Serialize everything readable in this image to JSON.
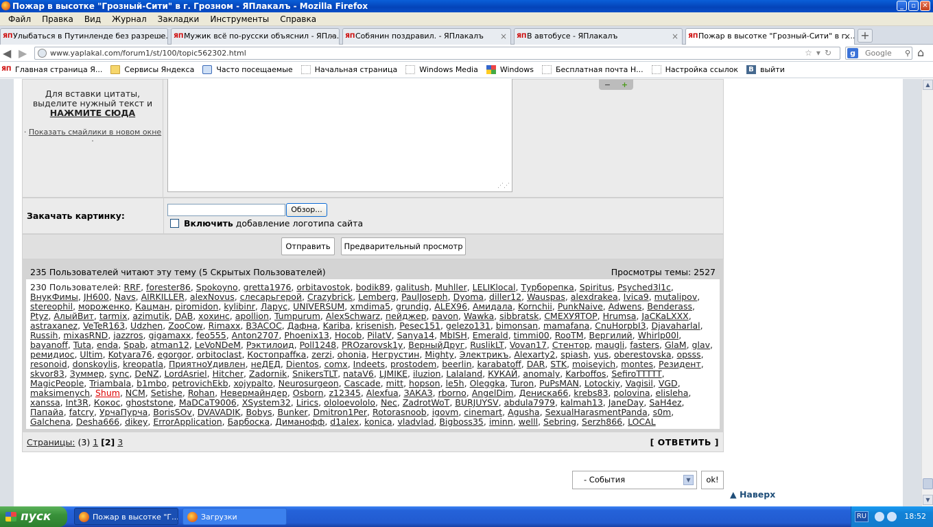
{
  "window": {
    "title": "Пожар в высотке \"Грозный-Сити\" в г. Грозном - ЯПлакалъ - Mozilla Firefox"
  },
  "menu": [
    "Файл",
    "Правка",
    "Вид",
    "Журнал",
    "Закладки",
    "Инструменты",
    "Справка"
  ],
  "tabs": [
    {
      "label": "Улыбаться в Путинленде без разреше..."
    },
    {
      "label": "Мужик всё по-русски объяснил - ЯПла..."
    },
    {
      "label": "Собянин поздравил. - ЯПлакалъ"
    },
    {
      "label": "В автобусе - ЯПлакалъ"
    },
    {
      "label": "Пожар в высотке \"Грозный-Сити\" в г. ..."
    }
  ],
  "tab_icon": "ЯП",
  "nav": {
    "url": "www.yaplakal.com/forum1/st/100/topic562302.html",
    "search_placeholder": "Google"
  },
  "bookmarks": [
    {
      "label": "Главная страница Я...",
      "icon": "ЯП"
    },
    {
      "label": "Сервисы Яндекса",
      "icon": "folder-icon"
    },
    {
      "label": "Часто посещаемые",
      "icon": "search-icon"
    },
    {
      "label": "Начальная страница",
      "icon": "page-icon"
    },
    {
      "label": "Windows Media",
      "icon": "page-icon"
    },
    {
      "label": "Windows",
      "icon": "windows-icon"
    },
    {
      "label": "Бесплатная почта Н...",
      "icon": "page-icon"
    },
    {
      "label": "Настройка ссылок",
      "icon": "page-icon"
    },
    {
      "label": "выйти",
      "icon": "В"
    }
  ],
  "form": {
    "quote_help": [
      "Для вставки цитаты,",
      "выделите нужный текст и"
    ],
    "quote_click": "НАЖМИТЕ СЮДА",
    "show_smiles": "Показать смайлики в новом окне",
    "upload_label": "Закачать картинку:",
    "browse": "Обзор...",
    "logo_bold": "Включить",
    "logo_rest": " добавление логотипа сайта",
    "send": "Отправить",
    "preview": "Предварительный просмотр"
  },
  "readers": {
    "header": "235 Пользователей читают эту тему (5 Скрытых Пользователей)",
    "views": "Просмотры темы: 2527",
    "prefix": "230 Пользователей: ",
    "users": [
      "RRF",
      "forester86",
      "Spokoyno",
      "gretta1976",
      "orbitavostok",
      "bodik89",
      "galitush",
      "Muhller",
      "LELIKlocal",
      "Турборепка",
      "Spiritus",
      "Psyched3l1c",
      "ВнукФимы",
      "JH600",
      "Navs",
      "AIRKILLER",
      "alexNovus",
      "слесарьгерой",
      "Crazybrick",
      "Lemberg",
      "PaulJoseph",
      "Dyoma",
      "diller12",
      "Wauspas",
      "alexdrakea",
      "Ivica9",
      "mutalipov",
      "stereophil",
      "мороженко",
      "Кацман",
      "piromidon",
      "kylibinr",
      "Ларус",
      "UNIVERSUM",
      "xmdima5",
      "grundig",
      "ALEX96",
      "Амидала",
      "Kornchii",
      "PunkNaive",
      "Adwens",
      "Benderass",
      "Ptyz",
      "АлыйВит",
      "tarmix",
      "azimutik",
      "DAB",
      "хохинс",
      "apollion",
      "Tumpurum",
      "AlexSchwarz",
      "пейджер",
      "pavon",
      "Wawka",
      "sibbratsk",
      "СМЕХУЯТОР",
      "Hrumsa",
      "JaCKaLXXX",
      "astraxanez",
      "VeTeR163",
      "Udzhen",
      "ZooCow",
      "Rimaxx",
      "ВЗАСОС",
      "Дафна",
      "Kariba",
      "krisenish",
      "Pesec151",
      "gelezo131",
      "bimonsan",
      "mamafana",
      "CnuHorpbI3",
      "Djavaharlal",
      "Russih",
      "mixasRND",
      "jazzros",
      "gigamaxx",
      "feo555",
      "Anton2707",
      "Phoenix13",
      "Hocob",
      "PilatV",
      "Sanya14",
      "MbISH",
      "Emerald",
      "timmi00",
      "RooTM",
      "Вергилий",
      "Whirlp00l",
      "bayanoff",
      "Tuta",
      "enda",
      "Spab",
      "atman12",
      "LeVoNDeM",
      "Рэктилоид",
      "Poll1248",
      "PROzarovsk1y",
      "ВерныйДруг",
      "RuslikLT",
      "Vovan17",
      "Стентор",
      "maugli",
      "fasters",
      "GlaM",
      "glav",
      "ремидиос",
      "Ultim",
      "Kotyara76",
      "egorgor",
      "orbitoclast",
      "Костопраffка",
      "zerzi",
      "ohonia",
      "Негрустин",
      "Mighty",
      "Электрикъ",
      "Alexarty2",
      "spiash",
      "yus",
      "oberestovska",
      "opsss",
      "resonoid",
      "donskoylis",
      "kreopatla",
      "ПриятноУдивлен",
      "неДЕД",
      "Dientos",
      "comx",
      "Indeets",
      "prostodem",
      "beerlin",
      "karabatoff",
      "DAR",
      "STK",
      "moiseyich",
      "montes",
      "Резидент",
      "skvor83",
      "Зуммер",
      "sync",
      "DeNZ",
      "LordAsriel",
      "Hitcher",
      "Zadornik",
      "SnikersTLT",
      "nataV6",
      "LJMIKE",
      "iluzion",
      "Lalaland",
      "КУКАЙ",
      "anomaly",
      "Karboffos",
      "SefiroTTTTT",
      "MagicPeople",
      "Triambala",
      "b1mbo",
      "petrovichEkb",
      "xojypalto",
      "Neurosurgeon",
      "Cascade",
      "mitt",
      "hopson",
      "le5h",
      "Oleggka",
      "Turon",
      "PuPsMAN",
      "Lotockiy",
      "Vagisil",
      "VGD",
      "maksimenych",
      "Shum",
      "NCM",
      "Setishe",
      "Rohan",
      "Невермайндер",
      "Osborn",
      "z12345",
      "Alexfua",
      "ЗАКАЗ",
      "rborno",
      "AngelDim",
      "Дениска66",
      "krebs83",
      "polovina",
      "elisleha",
      "xanssa",
      "Int3R",
      "Кокос",
      "ghoststone",
      "MaDCaT9006",
      "XSystem32",
      "Lirics",
      "ololoevololo",
      "Nec",
      "ZadrotWoT",
      "BURJUYSV",
      "abdula7979",
      "kalmah13",
      "JaneDay",
      "SaH4ez",
      "Папайа",
      "fatcry",
      "УрчаПурча",
      "BorisSOv",
      "DVAVADIK",
      "Bobys",
      "Bunker",
      "Dmitron1Per",
      "Rotorasnoob",
      "igovm",
      "cinemart",
      "Agusha",
      "SexualHarasmentPanda",
      "s0m",
      "Galchena",
      "Desha666",
      "dikey",
      "ErrorApplication",
      "Барбоска",
      "Диманофф",
      "d1alex",
      "konica",
      "vladvlad",
      "Bigboss35",
      "iminn",
      "welll",
      "Sebring",
      "Serzh866",
      "LOCAL"
    ],
    "highlighted_user": "Shum",
    "highlight_color": "#dd0000"
  },
  "pages": {
    "label": "Страницы:",
    "total": "(3)",
    "p1": "1",
    "current": "[2]",
    "p3": "3",
    "reply": "[ ОТВЕТИТЬ ]"
  },
  "jump": {
    "selected": "- События",
    "ok": "ok!",
    "top": "Наверх"
  },
  "taskbar": {
    "start": "пуск",
    "items": [
      "Пожар в высотке \"Г...",
      "Загрузки"
    ],
    "lang": "RU",
    "clock": "18:52"
  }
}
